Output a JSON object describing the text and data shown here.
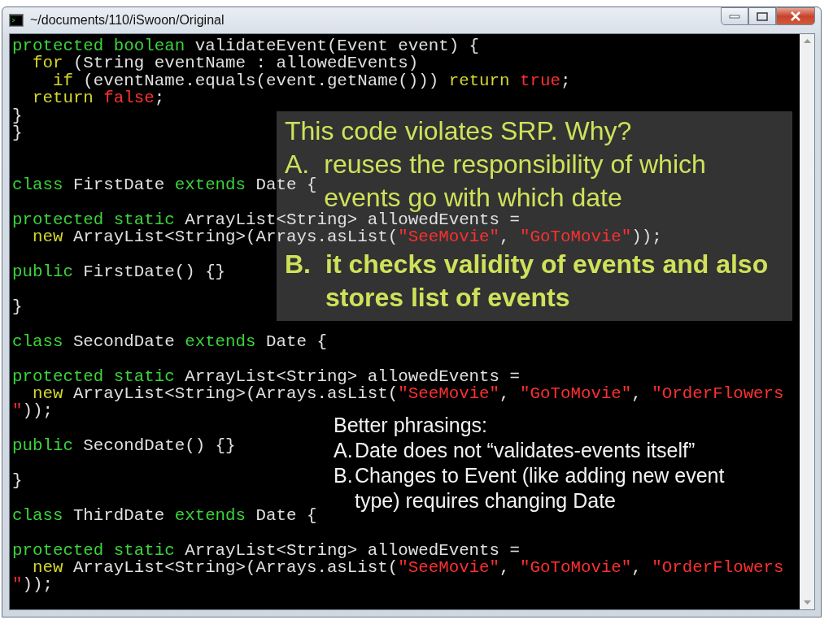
{
  "window": {
    "title": "~/documents/110/iSwoon/Original"
  },
  "code_blocks": [
    {
      "lines": [
        [
          {
            "kind": "keyword",
            "text": "protected boolean"
          },
          {
            "kind": "plain",
            "text": " validateEvent(Event event) {"
          }
        ],
        [
          {
            "kind": "control",
            "text": "  for"
          },
          {
            "kind": "plain",
            "text": " (String eventName : allowedEvents)"
          }
        ],
        [
          {
            "kind": "control",
            "text": "    if"
          },
          {
            "kind": "plain",
            "text": " (eventName.equals(event.getName())) "
          },
          {
            "kind": "control",
            "text": "return"
          },
          {
            "kind": "literal",
            "text": " true"
          },
          {
            "kind": "plain",
            "text": ";"
          }
        ],
        [
          {
            "kind": "control",
            "text": "  return"
          },
          {
            "kind": "literal",
            "text": " false"
          },
          {
            "kind": "plain",
            "text": ";"
          }
        ],
        [
          {
            "kind": "plain",
            "text": "}"
          }
        ],
        [
          {
            "kind": "plain",
            "text": "}"
          }
        ]
      ]
    },
    {
      "lines": [
        [
          {
            "kind": "keyword",
            "text": "class"
          },
          {
            "kind": "plain",
            "text": " FirstDate "
          },
          {
            "kind": "keyword",
            "text": "extends"
          },
          {
            "kind": "plain",
            "text": " Date {"
          }
        ]
      ]
    },
    {
      "lines": [
        [
          {
            "kind": "keyword",
            "text": "protected static"
          },
          {
            "kind": "plain",
            "text": " ArrayList<String> allowedEvents ="
          }
        ],
        [
          {
            "kind": "control",
            "text": "  new"
          },
          {
            "kind": "plain",
            "text": " ArrayList<String>(Arrays.asList("
          },
          {
            "kind": "literal",
            "text": "\"SeeMovie\""
          },
          {
            "kind": "plain",
            "text": ", "
          },
          {
            "kind": "literal",
            "text": "\"GoToMovie\""
          },
          {
            "kind": "plain",
            "text": "));"
          }
        ]
      ]
    },
    {
      "lines": [
        [
          {
            "kind": "keyword",
            "text": "public"
          },
          {
            "kind": "plain",
            "text": " FirstDate() {}"
          }
        ]
      ]
    },
    {
      "lines": [
        [
          {
            "kind": "plain",
            "text": "}"
          }
        ]
      ]
    },
    {
      "lines": [
        [
          {
            "kind": "keyword",
            "text": "class"
          },
          {
            "kind": "plain",
            "text": " SecondDate "
          },
          {
            "kind": "keyword",
            "text": "extends"
          },
          {
            "kind": "plain",
            "text": " Date {"
          }
        ]
      ]
    },
    {
      "lines": [
        [
          {
            "kind": "keyword",
            "text": "protected static"
          },
          {
            "kind": "plain",
            "text": " ArrayList<String> allowedEvents ="
          }
        ],
        [
          {
            "kind": "control",
            "text": "  new"
          },
          {
            "kind": "plain",
            "text": " ArrayList<String>(Arrays.asList("
          },
          {
            "kind": "literal",
            "text": "\"SeeMovie\""
          },
          {
            "kind": "plain",
            "text": ", "
          },
          {
            "kind": "literal",
            "text": "\"GoToMovie\""
          },
          {
            "kind": "plain",
            "text": ", "
          },
          {
            "kind": "literal",
            "text": "\"OrderFlowers"
          }
        ],
        [
          {
            "kind": "literal",
            "text": "\""
          },
          {
            "kind": "plain",
            "text": "));"
          }
        ]
      ]
    },
    {
      "lines": [
        [
          {
            "kind": "keyword",
            "text": "public"
          },
          {
            "kind": "plain",
            "text": " SecondDate() {}"
          }
        ]
      ]
    },
    {
      "lines": [
        [
          {
            "kind": "plain",
            "text": "}"
          }
        ]
      ]
    },
    {
      "lines": [
        [
          {
            "kind": "keyword",
            "text": "class"
          },
          {
            "kind": "plain",
            "text": " ThirdDate "
          },
          {
            "kind": "keyword",
            "text": "extends"
          },
          {
            "kind": "plain",
            "text": " Date {"
          }
        ]
      ]
    },
    {
      "lines": [
        [
          {
            "kind": "keyword",
            "text": "protected static"
          },
          {
            "kind": "plain",
            "text": " ArrayList<String> allowedEvents ="
          }
        ],
        [
          {
            "kind": "control",
            "text": "  new"
          },
          {
            "kind": "plain",
            "text": " ArrayList<String>(Arrays.asList("
          },
          {
            "kind": "literal",
            "text": "\"SeeMovie\""
          },
          {
            "kind": "plain",
            "text": ", "
          },
          {
            "kind": "literal",
            "text": "\"GoToMovie\""
          },
          {
            "kind": "plain",
            "text": ", "
          },
          {
            "kind": "literal",
            "text": "\"OrderFlowers"
          }
        ],
        [
          {
            "kind": "literal",
            "text": "\""
          },
          {
            "kind": "plain",
            "text": "));"
          }
        ]
      ]
    }
  ],
  "callout": {
    "title": "This code violates SRP.  Why?",
    "items": [
      {
        "label": "A.",
        "text": "reuses the responsibility of which events go with which date",
        "bold": false
      },
      {
        "label": "B.",
        "text": "it checks validity of events and also stores list of events",
        "bold": true
      }
    ]
  },
  "note": {
    "title": "Better phrasings:",
    "items": [
      {
        "label": "A.",
        "text": "Date does not “validates-events itself”"
      },
      {
        "label": "B.",
        "text": "Changes to Event (like adding new event type) requires changing Date"
      }
    ]
  }
}
